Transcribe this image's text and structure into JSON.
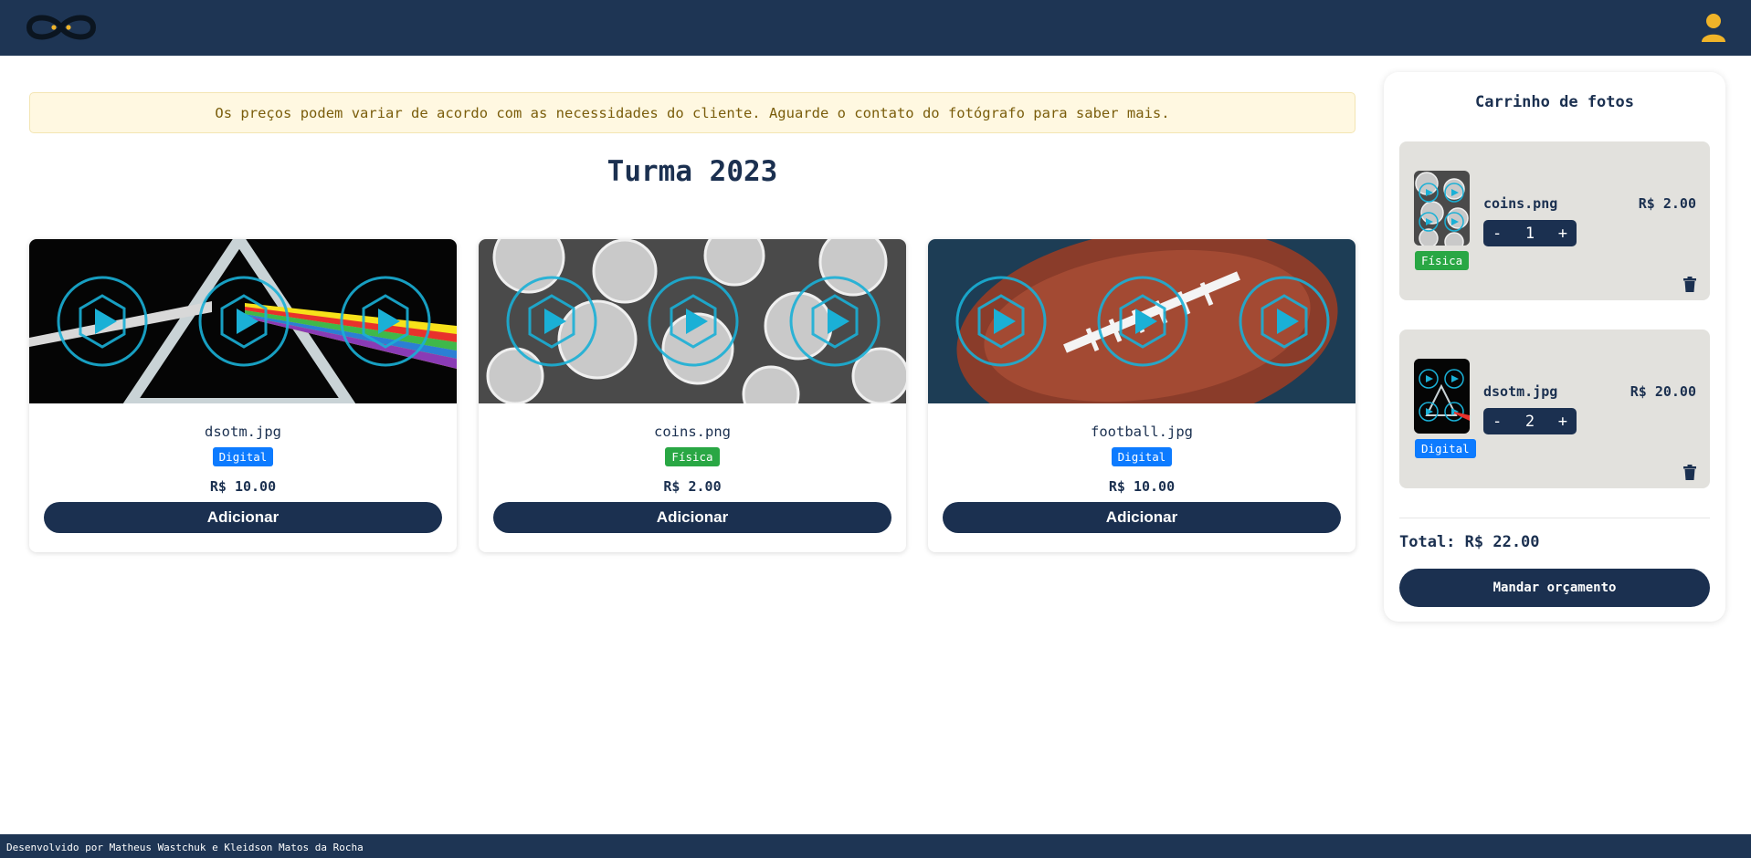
{
  "header": {
    "logo": "infinity-logo",
    "user_icon": "user-icon"
  },
  "notice": {
    "text": "Os preços podem variar de acordo com as necessidades do cliente. Aguarde o contato do fotógrafo para saber mais."
  },
  "gallery": {
    "title": "Turma 2023",
    "cards": [
      {
        "name": "dsotm.jpg",
        "badge": "Digital",
        "badge_type": "digital",
        "price": "R$ 10.00",
        "button": "Adicionar"
      },
      {
        "name": "coins.png",
        "badge": "Física",
        "badge_type": "fisica",
        "price": "R$ 2.00",
        "button": "Adicionar"
      },
      {
        "name": "football.jpg",
        "badge": "Digital",
        "badge_type": "digital",
        "price": "R$ 10.00",
        "button": "Adicionar"
      }
    ]
  },
  "cart": {
    "title": "Carrinho de fotos",
    "items": [
      {
        "name": "coins.png",
        "badge": "Física",
        "price": "R$ 2.00",
        "minus": "-",
        "qty": "1",
        "plus": "+"
      },
      {
        "name": "dsotm.jpg",
        "badge": "Digital",
        "price": "R$ 20.00",
        "minus": "-",
        "qty": "2",
        "plus": "+"
      }
    ],
    "total": "Total: R$ 22.00",
    "quote_button": "Mandar orçamento"
  },
  "footer": {
    "text": "Desenvolvido por Matheus Wastchuk e Kleidson Matos da Rocha"
  },
  "colors": {
    "navy": "#1e3554",
    "accent": "#f0b429",
    "digital": "#0d7bff",
    "fisica": "#29a744",
    "notice_bg": "#fff8e1"
  }
}
